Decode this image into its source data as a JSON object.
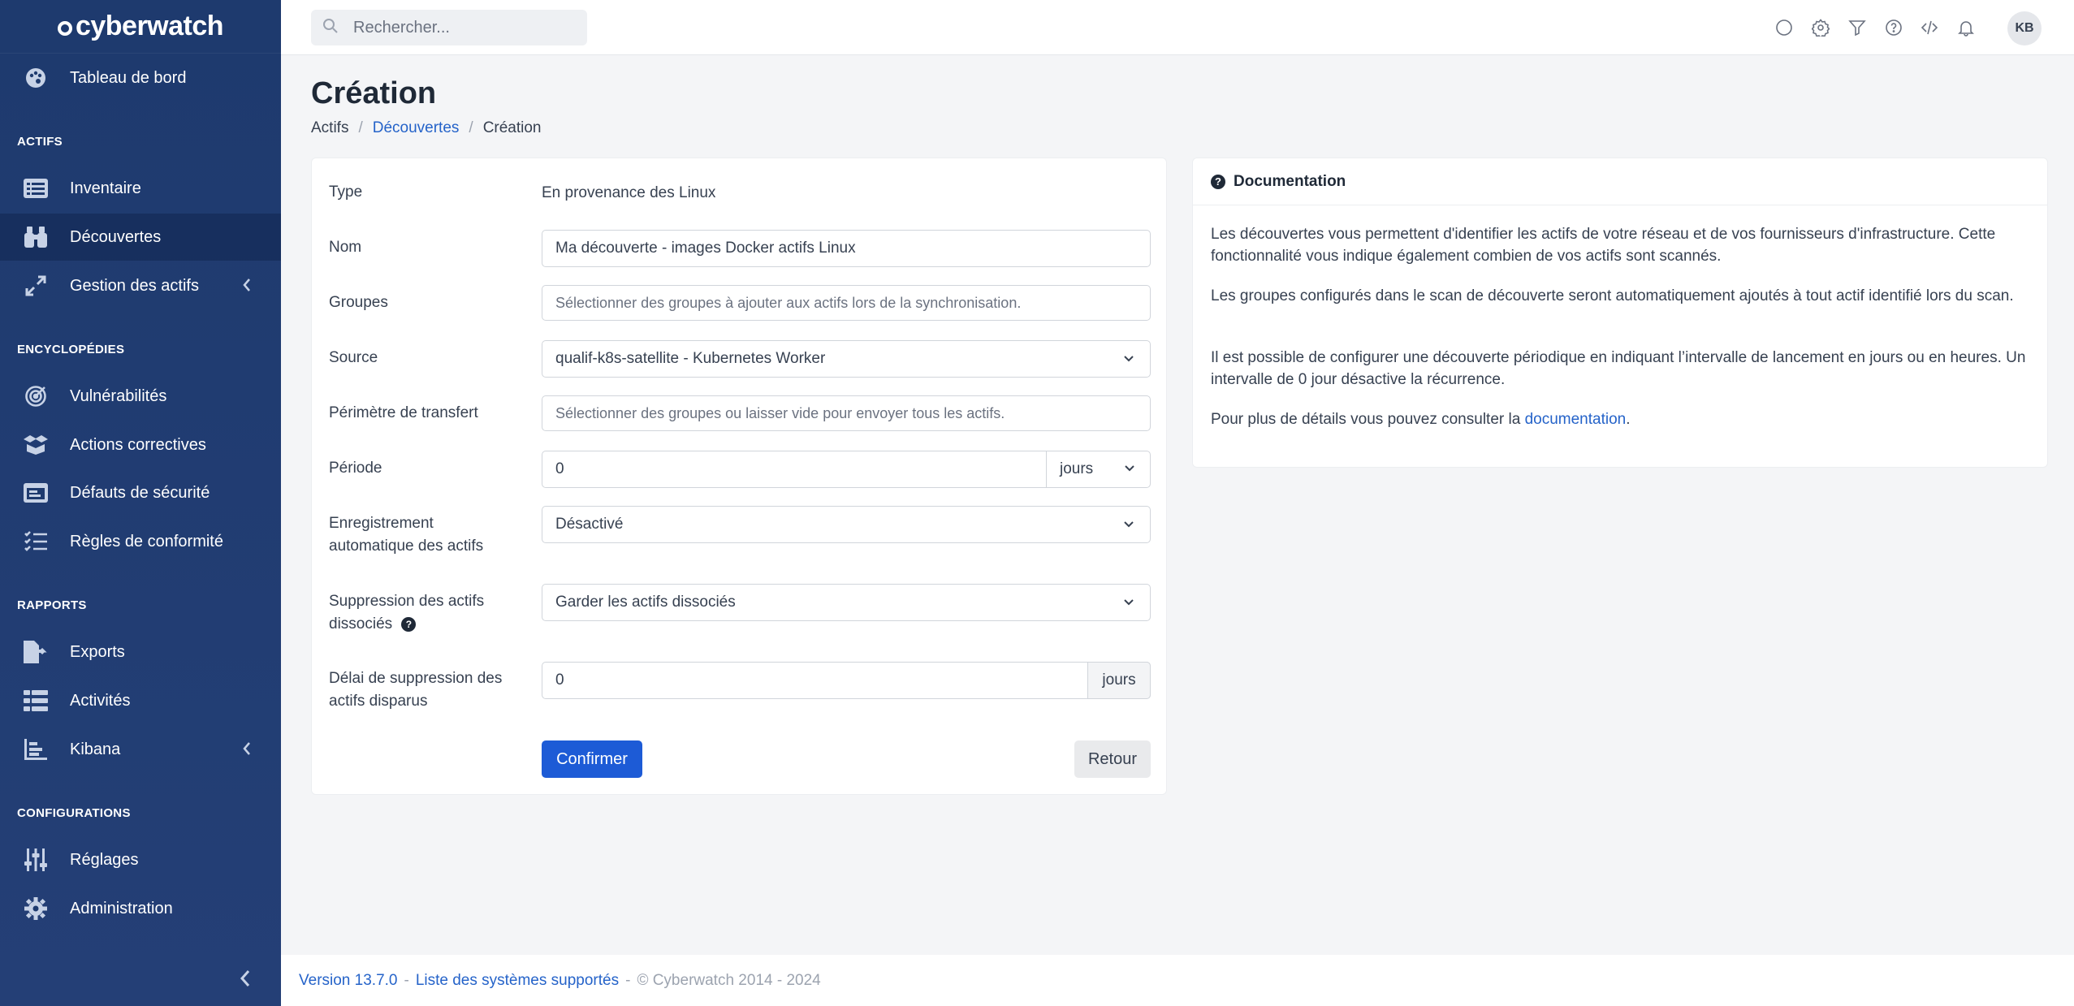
{
  "app": {
    "brand": "cyberwatch"
  },
  "sidebar": {
    "dashboard": "Tableau de bord",
    "sections": {
      "actifs": "ACTIFS",
      "encyclopedies": "ENCYCLOPÉDIES",
      "rapports": "RAPPORTS",
      "configurations": "CONFIGURATIONS"
    },
    "items": {
      "inventaire": "Inventaire",
      "decouvertes": "Découvertes",
      "gestion": "Gestion des actifs",
      "vulnerabilites": "Vulnérabilités",
      "actions": "Actions correctives",
      "defauts": "Défauts de sécurité",
      "regles": "Règles de conformité",
      "exports": "Exports",
      "activites": "Activités",
      "kibana": "Kibana",
      "reglages": "Réglages",
      "administration": "Administration"
    }
  },
  "topbar": {
    "search_placeholder": "Rechercher...",
    "user_initials": "KB"
  },
  "page": {
    "title": "Création",
    "breadcrumb": [
      "Actifs",
      "/",
      "Découvertes",
      "/",
      "Création"
    ]
  },
  "form": {
    "type_label": "Type",
    "type_value": "En provenance des Linux",
    "nom_label": "Nom",
    "nom_value": "Ma découverte - images Docker actifs Linux",
    "groupes_label": "Groupes",
    "groupes_placeholder": "Sélectionner des groupes à ajouter aux actifs lors de la synchronisation.",
    "source_label": "Source",
    "source_value": "qualif-k8s-satellite - Kubernetes Worker",
    "perimetre_label": "Périmètre de transfert",
    "perimetre_placeholder": "Sélectionner des groupes ou laisser vide pour envoyer tous les actifs.",
    "periode_label": "Période",
    "periode_value": "0",
    "periode_unit": "jours",
    "enregistrement_label": "Enregistrement automatique des actifs",
    "enregistrement_value": "Désactivé",
    "suppression_label": "Suppression des actifs dissociés",
    "suppression_value": "Garder les actifs dissociés",
    "delai_label": "Délai de suppression des actifs disparus",
    "delai_value": "0",
    "delai_unit": "jours",
    "confirm": "Confirmer",
    "back": "Retour"
  },
  "documentation": {
    "title": "Documentation",
    "p1": "Les découvertes vous permettent d'identifier les actifs de votre réseau et de vos fournisseurs d'infrastructure. Cette fonctionnalité vous indique également combien de vos actifs sont scannés.",
    "p2": "Les groupes configurés dans le scan de découverte seront automatiquement ajoutés à tout actif identifié lors du scan.",
    "p3": "Il est possible de configurer une découverte périodique en indiquant l’intervalle de lancement en jours ou en heures. Un intervalle de 0 jour désactive la récurrence.",
    "p4_prefix": "Pour plus de détails vous pouvez consulter la ",
    "p4_link": "documentation",
    "p4_suffix": "."
  },
  "footer": {
    "version": "Version 13.7.0",
    "sep1": "-",
    "supported": "Liste des systèmes supportés",
    "sep2": "-",
    "copyright": "© Cyberwatch 2014 - 2024"
  },
  "colors": {
    "sidebar": "#1e3a6e",
    "primary": "#1d5bd6",
    "link": "#2563c9"
  }
}
